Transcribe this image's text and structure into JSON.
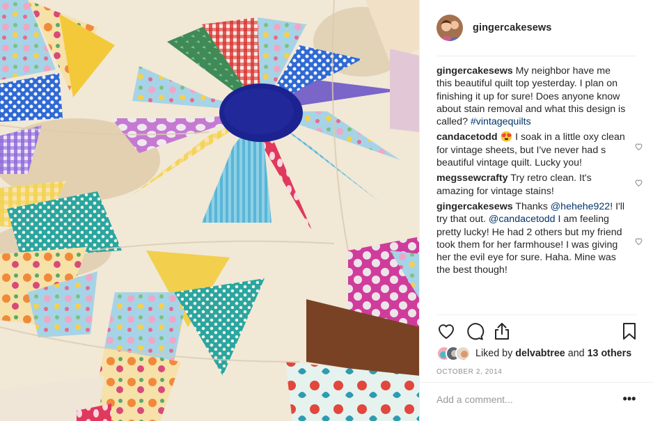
{
  "post": {
    "author": "gingercakesews",
    "image_description_icon": "quilt-photo",
    "caption": {
      "user": "gingercakesews",
      "text": " My neighbor have me this beautiful quilt top yesterday. I plan on finishing it up for sure! Does anyone know about stain removal and what this design is called? ",
      "hashtag": "#vintagequilts"
    },
    "comments": [
      {
        "user": "candacetodd",
        "emoji": "😍",
        "text": " I soak in a little oxy clean for vintage sheets, but I've never had s beautiful vintage quilt. Lucky you!"
      },
      {
        "user": "megssewcrafty",
        "text": " Try retro clean. It's amazing for vintage stains!"
      },
      {
        "user": "gingercakesews",
        "text_before": " Thanks ",
        "mention1": "@hehehe922",
        "text_mid": "! I'll try that out. ",
        "mention2": "@candacetodd",
        "text_after": " I am feeling pretty lucky! He had 2 others but my friend took them for her farmhouse! I was giving her the evil eye for sure. Haha. Mine was the best though!"
      }
    ],
    "likes": {
      "prefix": "Liked by ",
      "first_user": "delvabtree",
      "joiner": " and ",
      "others": "13 others"
    },
    "date": "OCTOBER 2, 2014",
    "add_comment_placeholder": "Add a comment...",
    "more_label": "•••"
  },
  "icons": {
    "like": "heart-icon",
    "comment": "comment-icon",
    "share": "share-icon",
    "save": "bookmark-icon",
    "more": "more-options-icon"
  },
  "colors": {
    "text": "#262626",
    "muted": "#8e8e8e",
    "link": "#003569",
    "divider": "#efefef",
    "heart_emoji": "#e8353f"
  }
}
